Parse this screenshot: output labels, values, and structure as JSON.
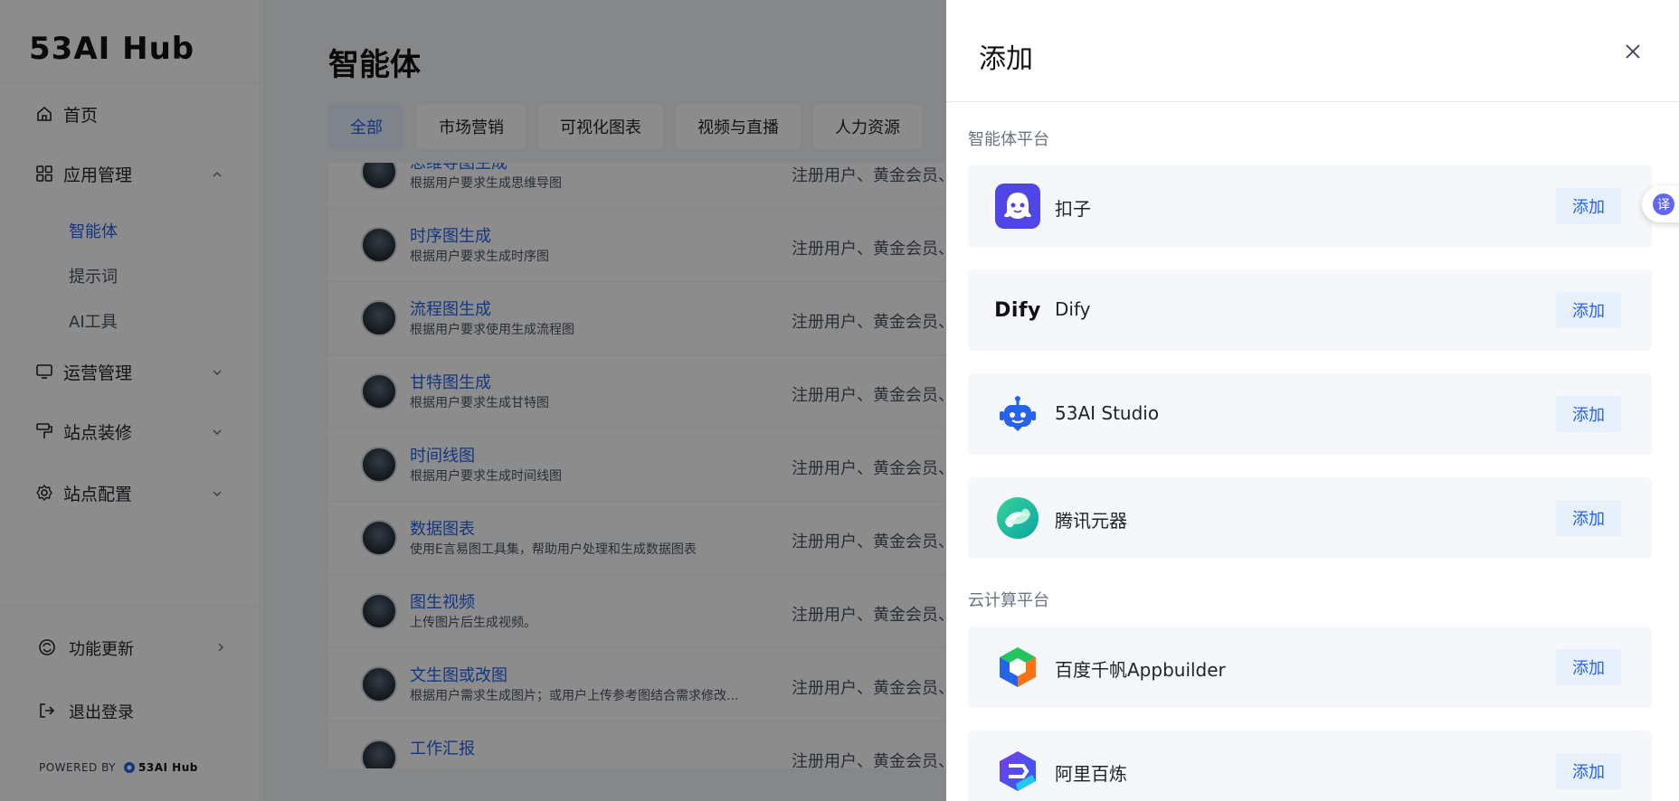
{
  "sidebar": {
    "logo": "53AI Hub",
    "items": [
      {
        "label": "首页",
        "icon": "home-icon"
      },
      {
        "label": "应用管理",
        "icon": "apps-grid-icon",
        "expanded": true
      },
      {
        "label": "运营管理",
        "icon": "monitor-icon"
      },
      {
        "label": "站点装修",
        "icon": "paint-roller-icon"
      },
      {
        "label": "站点配置",
        "icon": "gear-icon"
      }
    ],
    "sub_items": [
      "智能体",
      "提示词",
      "AI工具"
    ],
    "active_sub_item": "智能体",
    "bottom": {
      "update": "功能更新",
      "logout": "退出登录"
    },
    "powered_by": "POWERED BY",
    "powered_brand": "53AI Hub"
  },
  "main": {
    "title": "智能体",
    "tabs": [
      "全部",
      "市场营销",
      "可视化图表",
      "视频与直播",
      "人力资源"
    ],
    "active_tab": "全部",
    "rows": [
      {
        "name": "思维导图生成",
        "desc": "根据用户要求生成思维导图",
        "perm": "注册用户、黄金会员、"
      },
      {
        "name": "时序图生成",
        "desc": "根据用户要求生成时序图",
        "perm": "注册用户、黄金会员、"
      },
      {
        "name": "流程图生成",
        "desc": "根据用户要求使用生成流程图",
        "perm": "注册用户、黄金会员、"
      },
      {
        "name": "甘特图生成",
        "desc": "根据用户要求生成甘特图",
        "perm": "注册用户、黄金会员、"
      },
      {
        "name": "时间线图",
        "desc": "根据用户要求生成时间线图",
        "perm": "注册用户、黄金会员、"
      },
      {
        "name": "数据图表",
        "desc": "使用E言易图工具集，帮助用户处理和生成数据图表",
        "perm": "注册用户、黄金会员、"
      },
      {
        "name": "图生视频",
        "desc": "上传图片后生成视频。",
        "perm": "注册用户、黄金会员、"
      },
      {
        "name": "文生图或改图",
        "desc": "根据用户需求生成图片；或用户上传参考图结合需求修改...",
        "perm": "注册用户、黄金会员、"
      },
      {
        "name": "工作汇报",
        "desc": "",
        "perm": "注册用户、黄金会员、"
      }
    ]
  },
  "drawer": {
    "title": "添加",
    "sections": [
      {
        "title": "智能体平台",
        "items": [
          {
            "label": "扣子",
            "icon": "coze-icon"
          },
          {
            "label": "Dify",
            "icon": "dify-logo-icon",
            "logo_text": "Dify"
          },
          {
            "label": "53AI Studio",
            "icon": "robot-icon"
          },
          {
            "label": "腾讯元器",
            "icon": "tencent-yuanqi-icon"
          }
        ]
      },
      {
        "title": "云计算平台",
        "items": [
          {
            "label": "百度千帆Appbuilder",
            "icon": "baidu-qianfan-icon"
          },
          {
            "label": "阿里百炼",
            "icon": "ali-bailian-icon"
          }
        ]
      }
    ],
    "add_label": "添加"
  },
  "translate_fab": {
    "label": "译"
  },
  "colors": {
    "accent": "#2563eb",
    "overlay": "rgba(0,0,0,0.45)",
    "card_bg": "#f5f7fa",
    "add_btn_bg": "#e8f0fc"
  }
}
